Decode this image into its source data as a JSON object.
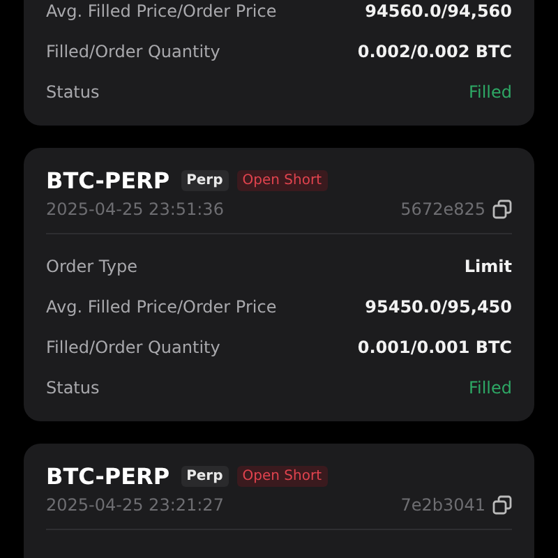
{
  "orders": [
    {
      "rows": [
        {
          "label": "Avg. Filled Price/Order Price",
          "value": "94560.0/94,560",
          "kind": "plain"
        },
        {
          "label": "Filled/Order Quantity",
          "value": "0.002/0.002 BTC",
          "kind": "plain"
        },
        {
          "label": "Status",
          "value": "Filled",
          "kind": "status"
        }
      ]
    },
    {
      "header": {
        "symbol": "BTC-PERP",
        "type_tag": "Perp",
        "side_tag": {
          "text": "Open Short",
          "kind": "sell"
        },
        "time": "2025-04-25 23:51:36",
        "order_id": "5672e825"
      },
      "rows": [
        {
          "label": "Order Type",
          "value": "Limit",
          "kind": "plain"
        },
        {
          "label": "Avg. Filled Price/Order Price",
          "value": "95450.0/95,450",
          "kind": "plain"
        },
        {
          "label": "Filled/Order Quantity",
          "value": "0.001/0.001 BTC",
          "kind": "plain"
        },
        {
          "label": "Status",
          "value": "Filled",
          "kind": "status"
        }
      ]
    },
    {
      "header": {
        "symbol": "BTC-PERP",
        "type_tag": "Perp",
        "side_tag": {
          "text": "Open Short",
          "kind": "sell"
        },
        "time": "2025-04-25 23:21:27",
        "order_id": "7e2b3041"
      }
    }
  ]
}
